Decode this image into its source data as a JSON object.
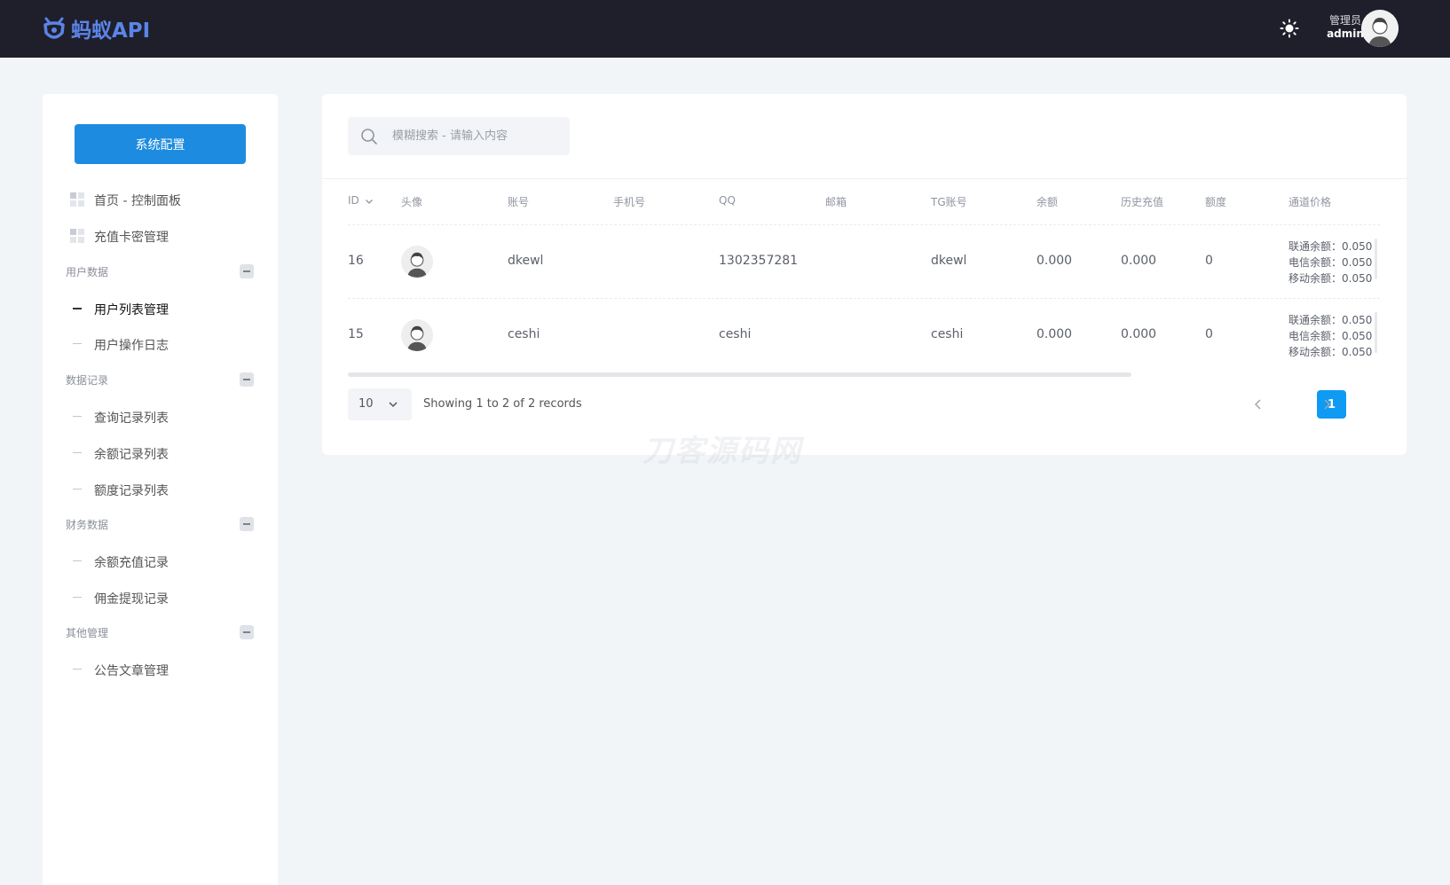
{
  "app": {
    "logo_text": "蚂蚁API",
    "brand_color": "#5b84e8",
    "topbar_color": "#1f1f2c",
    "accent_color": "#1d8ce0"
  },
  "header": {
    "theme_icon": "sun-icon",
    "user_role": "管理员",
    "user_name": "admin"
  },
  "sidebar": {
    "config_button": "系统配置",
    "top_items": [
      {
        "label": "首页 - 控制面板",
        "icon": "dashboard-grid-icon"
      },
      {
        "label": "充值卡密管理",
        "icon": "dashboard-grid-icon"
      }
    ],
    "groups": [
      {
        "title": "用户数据",
        "items": [
          {
            "label": "用户列表管理",
            "active": true
          },
          {
            "label": "用户操作日志"
          }
        ]
      },
      {
        "title": "数据记录",
        "items": [
          {
            "label": "查询记录列表"
          },
          {
            "label": "余额记录列表"
          },
          {
            "label": "额度记录列表"
          }
        ]
      },
      {
        "title": "财务数据",
        "items": [
          {
            "label": "余额充值记录"
          },
          {
            "label": "佣金提现记录"
          }
        ]
      },
      {
        "title": "其他管理",
        "items": [
          {
            "label": "公告文章管理"
          }
        ]
      }
    ]
  },
  "search": {
    "placeholder": "模糊搜索 - 请输入内容"
  },
  "table": {
    "columns": [
      "ID",
      "头像",
      "账号",
      "手机号",
      "QQ",
      "邮箱",
      "TG账号",
      "余额",
      "历史充值",
      "额度",
      "通道价格"
    ],
    "rows": [
      {
        "id": "16",
        "account": "dkewl",
        "phone": "",
        "qq": "1302357281",
        "email": "",
        "tg": "dkewl",
        "balance": "0.000",
        "history": "0.000",
        "quota": "0",
        "prices": [
          "联通余额：0.050",
          "电信余额：0.050",
          "移动余额：0.050"
        ]
      },
      {
        "id": "15",
        "account": "ceshi",
        "phone": "",
        "qq": "ceshi",
        "email": "",
        "tg": "ceshi",
        "balance": "0.000",
        "history": "0.000",
        "quota": "0",
        "prices": [
          "联通余额：0.050",
          "电信余额：0.050",
          "移动余额：0.050"
        ]
      }
    ]
  },
  "pagination": {
    "page_size": "10",
    "summary": "Showing 1 to 2 of 2 records",
    "current_page": "1"
  },
  "watermark": "刀客源码网"
}
